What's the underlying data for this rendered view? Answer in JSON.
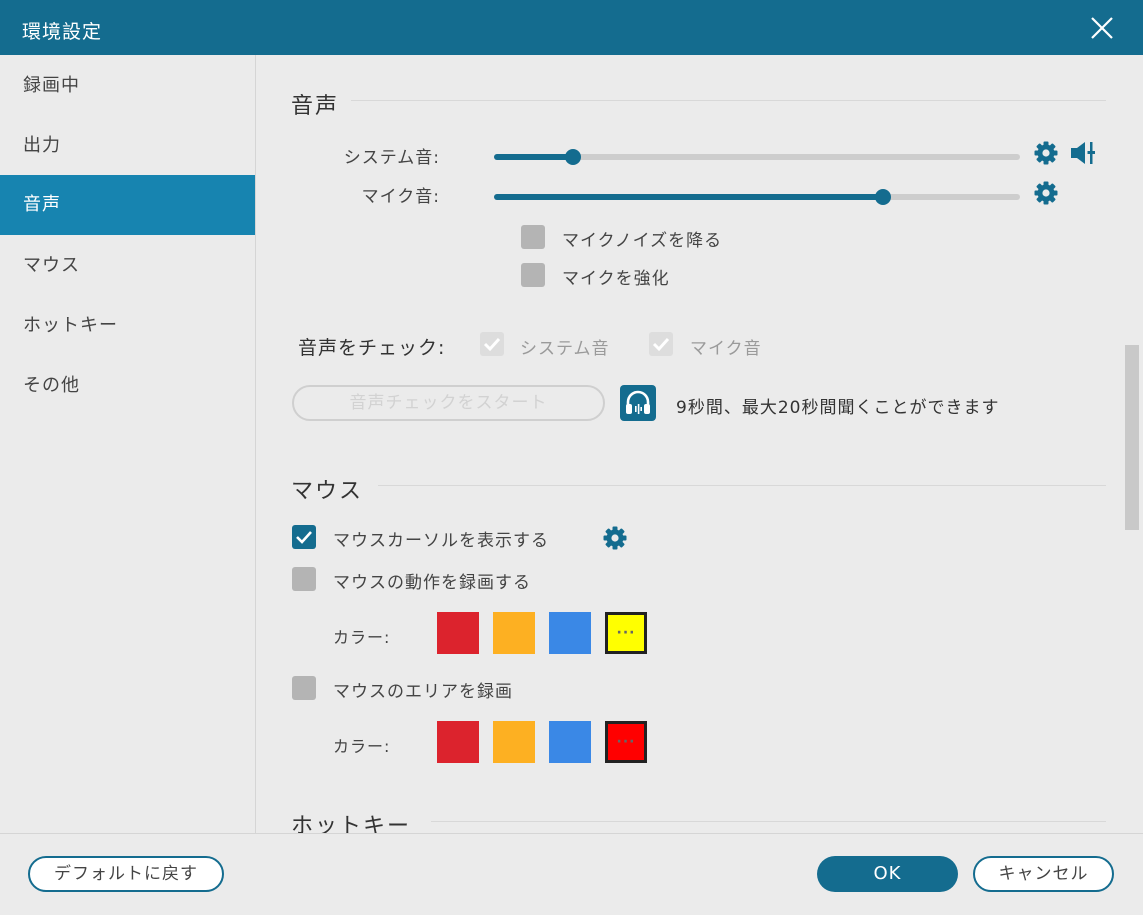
{
  "window": {
    "title": "環境設定"
  },
  "sidebar": {
    "items": [
      {
        "label": "録画中"
      },
      {
        "label": "出力"
      },
      {
        "label": "音声"
      },
      {
        "label": "マウス"
      },
      {
        "label": "ホットキー"
      },
      {
        "label": "その他"
      }
    ],
    "active_index": 2
  },
  "audio": {
    "title": "音声",
    "system_sound": {
      "label": "システム音:",
      "level": 0.15
    },
    "mic_sound": {
      "label": "マイク音:",
      "level": 0.74
    },
    "options": [
      {
        "label": "マイクノイズを降る",
        "checked": false
      },
      {
        "label": "マイクを強化",
        "checked": false
      }
    ],
    "check": {
      "label": "音声をチェック:",
      "system_label": "システム音",
      "mic_label": "マイク音",
      "start_button": "音声チェックをスタート",
      "hint": "9秒間、最大20秒間聞くことができます"
    }
  },
  "mouse": {
    "title": "マウス",
    "show_cursor": {
      "label": "マウスカーソルを表示する",
      "checked": true
    },
    "record_clicks": {
      "label": "マウスの動作を録画する",
      "checked": false,
      "color_label": "カラー:"
    },
    "record_area": {
      "label": "マウスのエリアを録画",
      "checked": false,
      "color_label": "カラー:"
    },
    "click_colors": [
      "#dc232d",
      "#fdb022",
      "#3a88e6"
    ],
    "click_custom_color": "#ffff00",
    "area_colors": [
      "#dc232d",
      "#fdb022",
      "#3a88e6"
    ],
    "area_custom_color": "#ff0000",
    "custom_marker": "···"
  },
  "hotkey": {
    "title": "ホットキー"
  },
  "footer": {
    "reset_button": "デフォルトに戻す",
    "ok_button": "OK",
    "cancel_button": "キャンセル"
  },
  "colors": {
    "accent": "#146c8f",
    "sidebar_active": "#1784b0"
  }
}
